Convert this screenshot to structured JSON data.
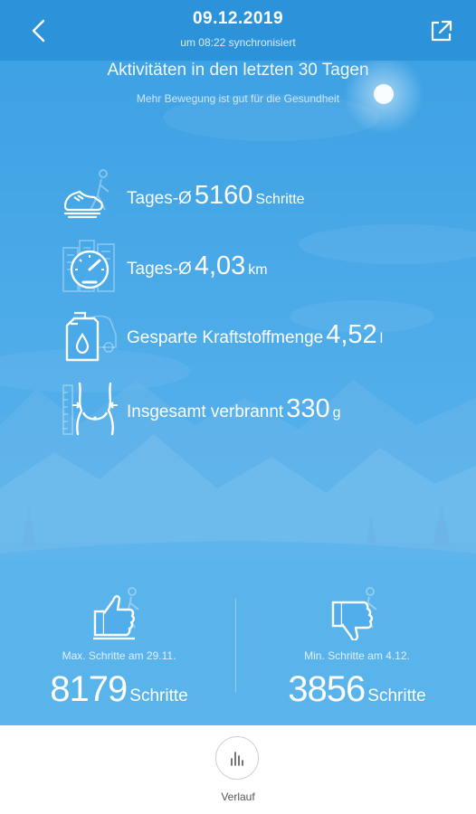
{
  "header": {
    "date": "09.12.2019",
    "sync_text": "um 08:22 synchronisiert"
  },
  "summary": {
    "title": "Aktivitäten in den letzten 30 Tagen",
    "subtitle": "Mehr Bewegung ist gut für die Gesundheit"
  },
  "stats": [
    {
      "icon": "walking-shoe-icon",
      "label": "Tages-Ø",
      "value": "5160",
      "unit": "Schritte"
    },
    {
      "icon": "speedometer-icon",
      "label": "Tages-Ø",
      "value": "4,03",
      "unit": "km"
    },
    {
      "icon": "fuel-canister-icon",
      "label": "Gesparte Kraftstoffmenge",
      "value": "4,52",
      "unit": "l"
    },
    {
      "icon": "waist-measure-icon",
      "label": "Insgesamt verbrannt",
      "value": "330",
      "unit": "g"
    }
  ],
  "records": {
    "max": {
      "icon": "thumbs-up-icon",
      "caption": "Max. Schritte am 29.11.",
      "value": "8179",
      "unit": "Schritte"
    },
    "min": {
      "icon": "thumbs-down-icon",
      "caption": "Min. Schritte am 4.12.",
      "value": "3856",
      "unit": "Schritte"
    }
  },
  "bottom": {
    "history_label": "Verlauf"
  },
  "colors": {
    "header_bg": "#2c93db",
    "body_bg": "#4aa9e8",
    "text": "#ffffff"
  }
}
